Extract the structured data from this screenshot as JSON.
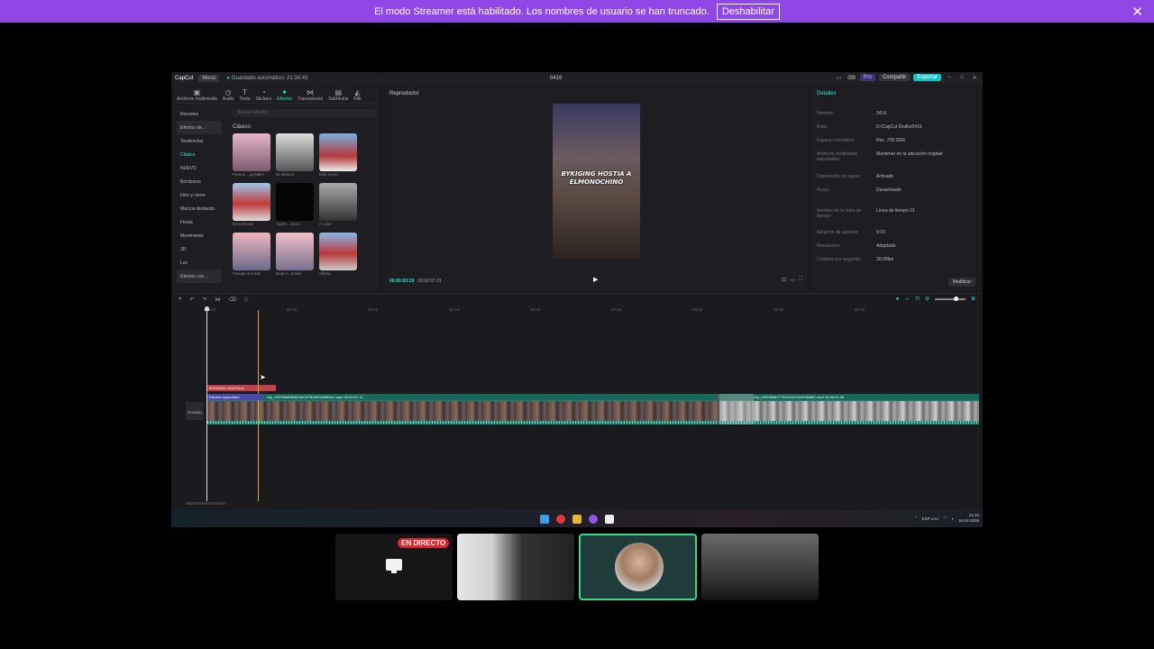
{
  "banner": {
    "message": "El modo Streamer está habilitado. Los nombres de usuario se han truncado.",
    "disable_label": "Deshabilitar",
    "close": "✕"
  },
  "app": {
    "logo": "CapCut",
    "menu_label": "Menú",
    "autosave": "Guardado automático: 21:34:43",
    "project_title": "0416",
    "pro_label": "Pro",
    "share_label": "Compartir",
    "export_label": "Exportar",
    "tools": [
      {
        "label": "Archivos multimedia",
        "icon": "▣"
      },
      {
        "label": "Audio",
        "icon": "◷"
      },
      {
        "label": "Texto",
        "icon": "T"
      },
      {
        "label": "Stickers",
        "icon": "◔"
      },
      {
        "label": "Efectos",
        "icon": "✦"
      },
      {
        "label": "Transiciones",
        "icon": "⋈"
      },
      {
        "label": "Subtítulos",
        "icon": "▤"
      },
      {
        "label": "Filtr",
        "icon": "◭"
      }
    ],
    "categories": [
      "Recortes",
      "Efectos de...",
      "Tendencias",
      "Clásico",
      "NUEVO",
      "Borrbozos",
      "Intro y cierre",
      "Marcos destacdo",
      "Fiesta",
      "Movimiento",
      "3D",
      "Lux",
      "Efectos con..."
    ],
    "search_placeholder": "Buscar efectos",
    "grid_title": "Clásico",
    "effects": [
      {
        "caption": "Puntos ...gonales"
      },
      {
        "caption": "En blanco"
      },
      {
        "caption": "Mini zoom"
      },
      {
        "caption": "Desenfocar"
      },
      {
        "caption": "Aparic...ienzo"
      },
      {
        "caption": "A color"
      },
      {
        "caption": "Paisaje serrado"
      },
      {
        "caption": "Deja e...ncider"
      },
      {
        "caption": "Viñeta"
      }
    ],
    "player": {
      "title": "Reproductor",
      "overlay_text": "BYKIGING HOSTIA A ELMONOCHINO",
      "current_time": "00:00:03:19",
      "total_time": "00:02:07:21"
    },
    "details": {
      "title": "Detalles",
      "rows": [
        {
          "k": "Nombre:",
          "v": "0416"
        },
        {
          "k": "Ruta:",
          "v": "D:/CapCut Drafts/0416"
        },
        {
          "k": "Espacio cromático:",
          "v": "Rec. 709 SDR"
        },
        {
          "k": "Archivos multimedia importados:",
          "v": "Mantener en la ubicación original"
        },
        {
          "k": "Disposición de capas:",
          "v": "Activado"
        },
        {
          "k": "Proxy:",
          "v": "Desactivado"
        },
        {
          "k": "Nombre de la línea de tiempo:",
          "v": "Línea de tiempo 01"
        },
        {
          "k": "Relación de aspecto:",
          "v": "9:16"
        },
        {
          "k": "Resolución:",
          "v": "Adaptado"
        },
        {
          "k": "Cuadros por segundo:",
          "v": "30.00fps"
        }
      ],
      "modify_label": "Modificar"
    },
    "timeline": {
      "ruler": [
        "00:00",
        "00:05",
        "00:10",
        "00:15",
        "00:20",
        "00:25",
        "00:30",
        "00:35",
        "00:40"
      ],
      "text_clip": "BYKIGING HOSTIA A",
      "fx_clip": "Efectos especiales",
      "video_clip_1": "clip_09PHBMHMAZZ6C5TBGKEA566Hun.mp4  00:00:07:12",
      "video_clip_2": "clip_09PHBMHTT5HGXAYSH0H8ABC.mp4  00:00:01:06",
      "track_label": "Portada"
    },
    "tray": {
      "lang": "ESP LAA",
      "time": "21:34",
      "date": "16-04-2026"
    }
  },
  "participants": {
    "live_label": "EN DIRECTO"
  }
}
